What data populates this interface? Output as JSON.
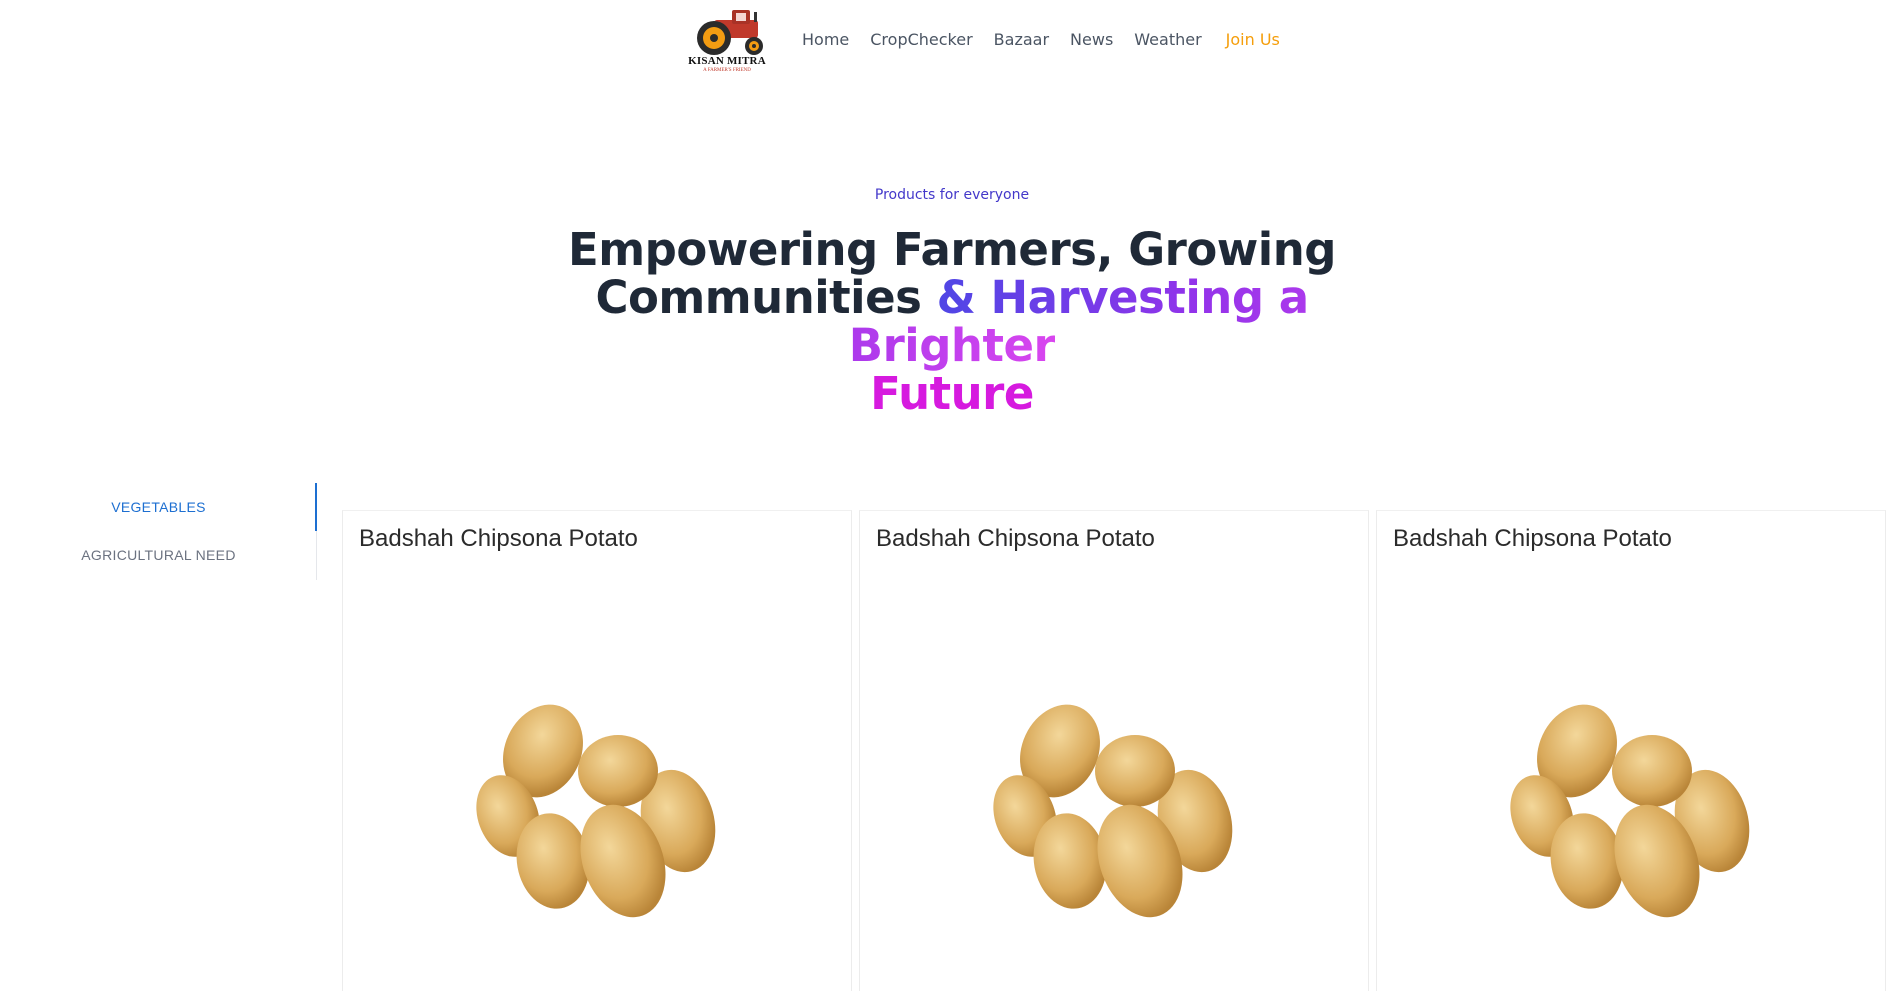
{
  "brand": {
    "name": "KISAN MITRA",
    "tagline": "A FARMER'S FRIEND"
  },
  "nav": {
    "items": [
      "Home",
      "CropChecker",
      "Bazaar",
      "News",
      "Weather"
    ],
    "cta": "Join Us"
  },
  "hero": {
    "eyebrow": "Products for everyone",
    "line1": "Empowering Farmers, Growing",
    "line2_plain": "Communities",
    "line2_highlight": "& Harvesting a Brighter",
    "line3_highlight": "Future"
  },
  "sidebar": {
    "items": [
      {
        "label": "VEGETABLES",
        "active": true
      },
      {
        "label": "AGRICULTURAL NEED",
        "active": false
      }
    ]
  },
  "products": [
    {
      "name": "Badshah Chipsona Potato",
      "image": "potato-pile"
    },
    {
      "name": "Badshah Chipsona Potato",
      "image": "potato-pile"
    },
    {
      "name": "Badshah Chipsona Potato",
      "image": "potato-pile"
    }
  ],
  "colors": {
    "nav_text": "#4b5563",
    "cta": "#f59e0b",
    "eyebrow": "#4338ca",
    "gradient_start": "#4f46e5",
    "gradient_end": "#d946ef",
    "sidebar_active": "#1d6fd1"
  }
}
